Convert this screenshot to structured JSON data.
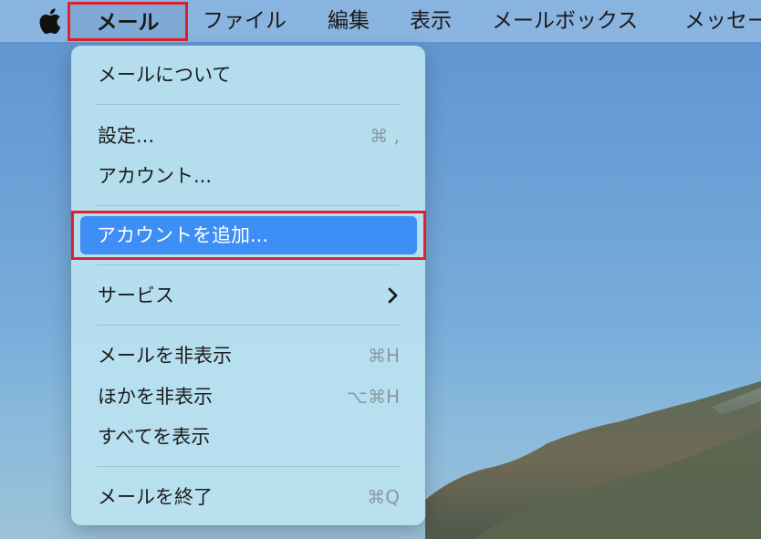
{
  "menubar": {
    "app_menu": "メール",
    "items": [
      "ファイル",
      "編集",
      "表示",
      "メールボックス",
      "メッセー"
    ]
  },
  "menu": {
    "about": "メールについて",
    "settings": {
      "label": "設定...",
      "shortcut": "⌘ ,"
    },
    "accounts": "アカウント...",
    "add_account": "アカウントを追加...",
    "services": "サービス",
    "hide": {
      "label": "メールを非表示",
      "shortcut": "⌘H"
    },
    "hide_others": {
      "label": "ほかを非表示",
      "shortcut": "⌥⌘H"
    },
    "show_all": "すべてを表示",
    "quit": {
      "label": "メールを終了",
      "shortcut": "⌘Q"
    }
  },
  "colors": {
    "highlight": "#3d8ef5",
    "annotation": "#e0202a"
  }
}
